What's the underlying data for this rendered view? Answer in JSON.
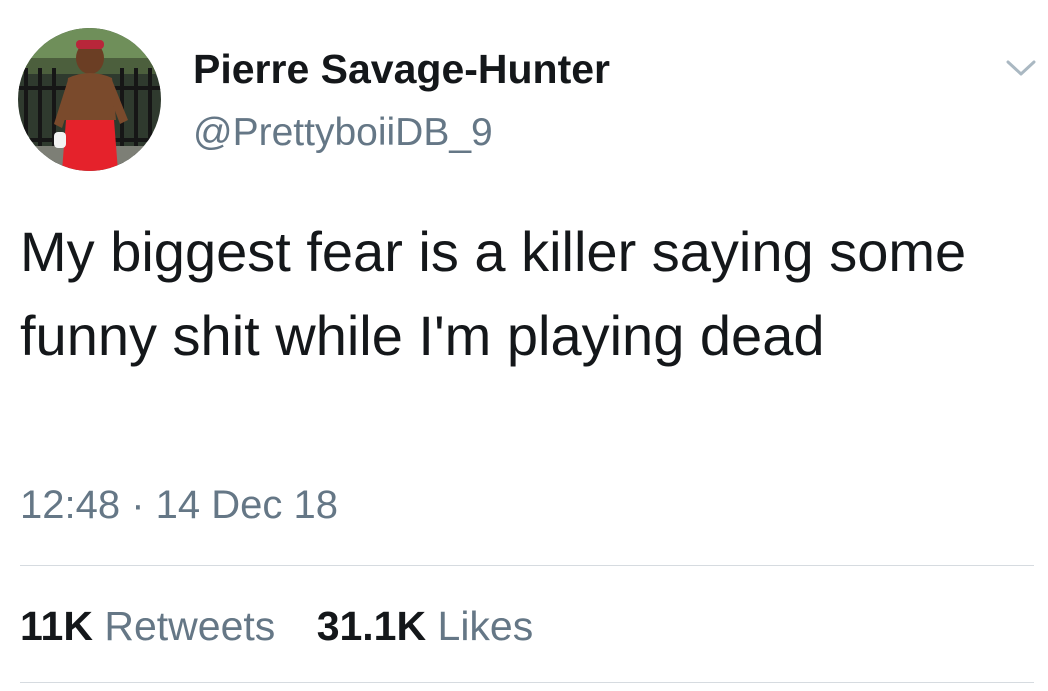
{
  "tweet": {
    "author": {
      "display_name": "Pierre Savage-Hunter",
      "handle": "@PrettyboiiDB_9"
    },
    "text": "My biggest fear is a killer saying some funny shit while I'm playing dead",
    "timestamp": "12:48 · 14 Dec 18",
    "stats": {
      "retweets_count": "11K",
      "retweets_label": "Retweets",
      "likes_count": "31.1K",
      "likes_label": "Likes"
    }
  },
  "icons": {
    "menu": "chevron-down-icon"
  },
  "colors": {
    "text_primary": "#14171a",
    "text_secondary": "#657786",
    "divider": "#d6dbe0",
    "background": "#ffffff"
  }
}
